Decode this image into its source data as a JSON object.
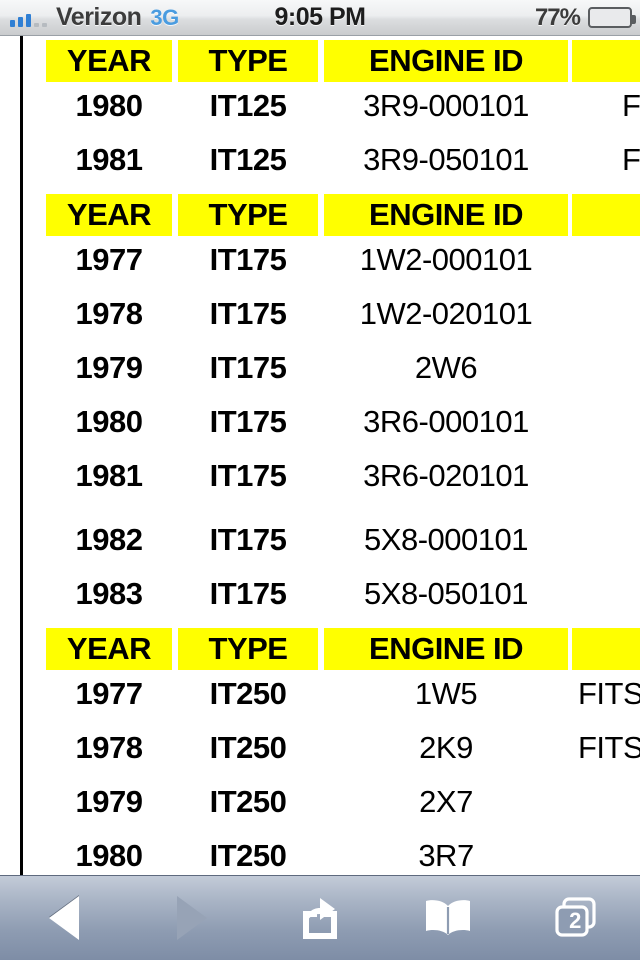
{
  "status_bar": {
    "carrier": "Verizon",
    "network": "3G",
    "clock": "9:05 PM",
    "battery_percent": "77%",
    "battery_level": 77,
    "signal_bars_filled": 3,
    "signal_bars_total": 5
  },
  "page": {
    "header_labels": {
      "year": "YEAR",
      "type": "TYPE",
      "engine_id": "ENGINE ID"
    },
    "sections": [
      {
        "id": "it125",
        "header": {
          "year": "YEAR",
          "type": "TYPE",
          "engine_id": "ENGINE ID"
        },
        "rows": [
          {
            "year": "1980",
            "type": "IT125",
            "engine_id": "3R9-000101",
            "fits": "F"
          },
          {
            "year": "1981",
            "type": "IT125",
            "engine_id": "3R9-050101",
            "fits": "F"
          }
        ]
      },
      {
        "id": "it175",
        "header": {
          "year": "YEAR",
          "type": "TYPE",
          "engine_id": "ENGINE ID"
        },
        "rows": [
          {
            "year": "1977",
            "type": "IT175",
            "engine_id": "1W2-000101",
            "fits": ""
          },
          {
            "year": "1978",
            "type": "IT175",
            "engine_id": "1W2-020101",
            "fits": ""
          },
          {
            "year": "1979",
            "type": "IT175",
            "engine_id": "2W6",
            "fits": ""
          },
          {
            "year": "1980",
            "type": "IT175",
            "engine_id": "3R6-000101",
            "fits": ""
          },
          {
            "year": "1981",
            "type": "IT175",
            "engine_id": "3R6-020101",
            "fits": ""
          },
          {
            "year": "1982",
            "type": "IT175",
            "engine_id": "5X8-000101",
            "fits": ""
          },
          {
            "year": "1983",
            "type": "IT175",
            "engine_id": "5X8-050101",
            "fits": ""
          }
        ]
      },
      {
        "id": "it250",
        "header": {
          "year": "YEAR",
          "type": "TYPE",
          "engine_id": "ENGINE ID"
        },
        "rows": [
          {
            "year": "1977",
            "type": "IT250",
            "engine_id": "1W5",
            "fits": "FITS"
          },
          {
            "year": "1978",
            "type": "IT250",
            "engine_id": "2K9",
            "fits": "FITS"
          },
          {
            "year": "1979",
            "type": "IT250",
            "engine_id": "2X7",
            "fits": ""
          },
          {
            "year": "1980",
            "type": "IT250",
            "engine_id": "3R7",
            "fits": ""
          }
        ]
      }
    ]
  },
  "toolbar": {
    "back_label": "Back",
    "forward_label": "Forward",
    "share_label": "Share",
    "bookmarks_label": "Bookmarks",
    "tabs_label": "Tabs",
    "tab_count": "2"
  },
  "colors": {
    "header_highlight": "#ffff00",
    "text": "#000000",
    "network_blue": "#4a9ce0",
    "signal_blue": "#2f7fd4",
    "battery_green": "#4fbf21",
    "toolbar_top": "#c3cbd8",
    "toolbar_bottom": "#7e8da6"
  }
}
